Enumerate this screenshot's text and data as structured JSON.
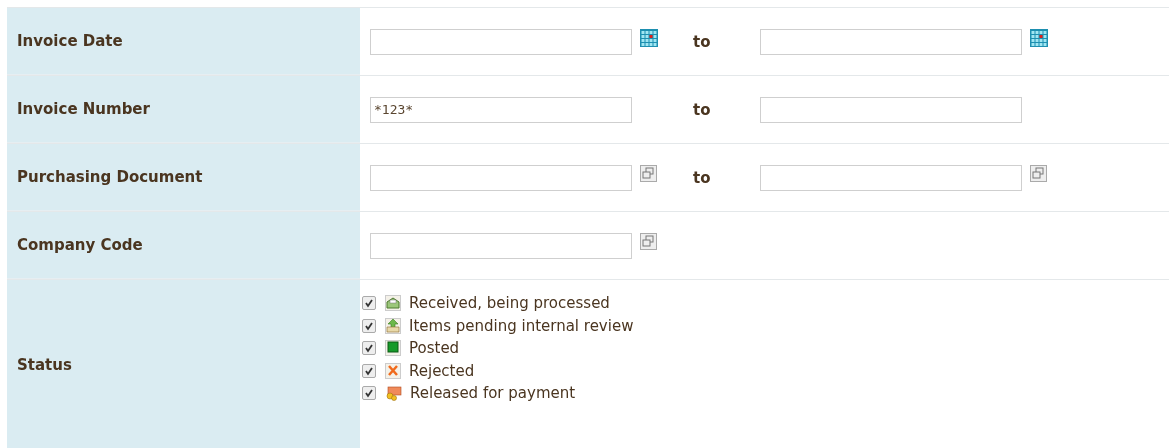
{
  "fields": [
    {
      "label": "Invoice Date",
      "kind": "date",
      "separator": "to"
    },
    {
      "label": "Invoice Number",
      "kind": "text",
      "from_value": "*123*",
      "separator": "to"
    },
    {
      "label": "Purchasing Document",
      "kind": "lookup",
      "separator": "to"
    },
    {
      "label": "Company Code",
      "kind": "lookup"
    }
  ],
  "status": {
    "label": "Status",
    "options": [
      {
        "label": "Received, being processed",
        "checked": true,
        "kind": "envelope"
      },
      {
        "label": "Items pending internal review",
        "checked": true,
        "kind": "upload"
      },
      {
        "label": "Posted",
        "checked": true,
        "kind": "posted"
      },
      {
        "label": "Rejected",
        "checked": true,
        "kind": "rejected"
      },
      {
        "label": "Released for payment",
        "checked": true,
        "kind": "payment"
      }
    ]
  }
}
